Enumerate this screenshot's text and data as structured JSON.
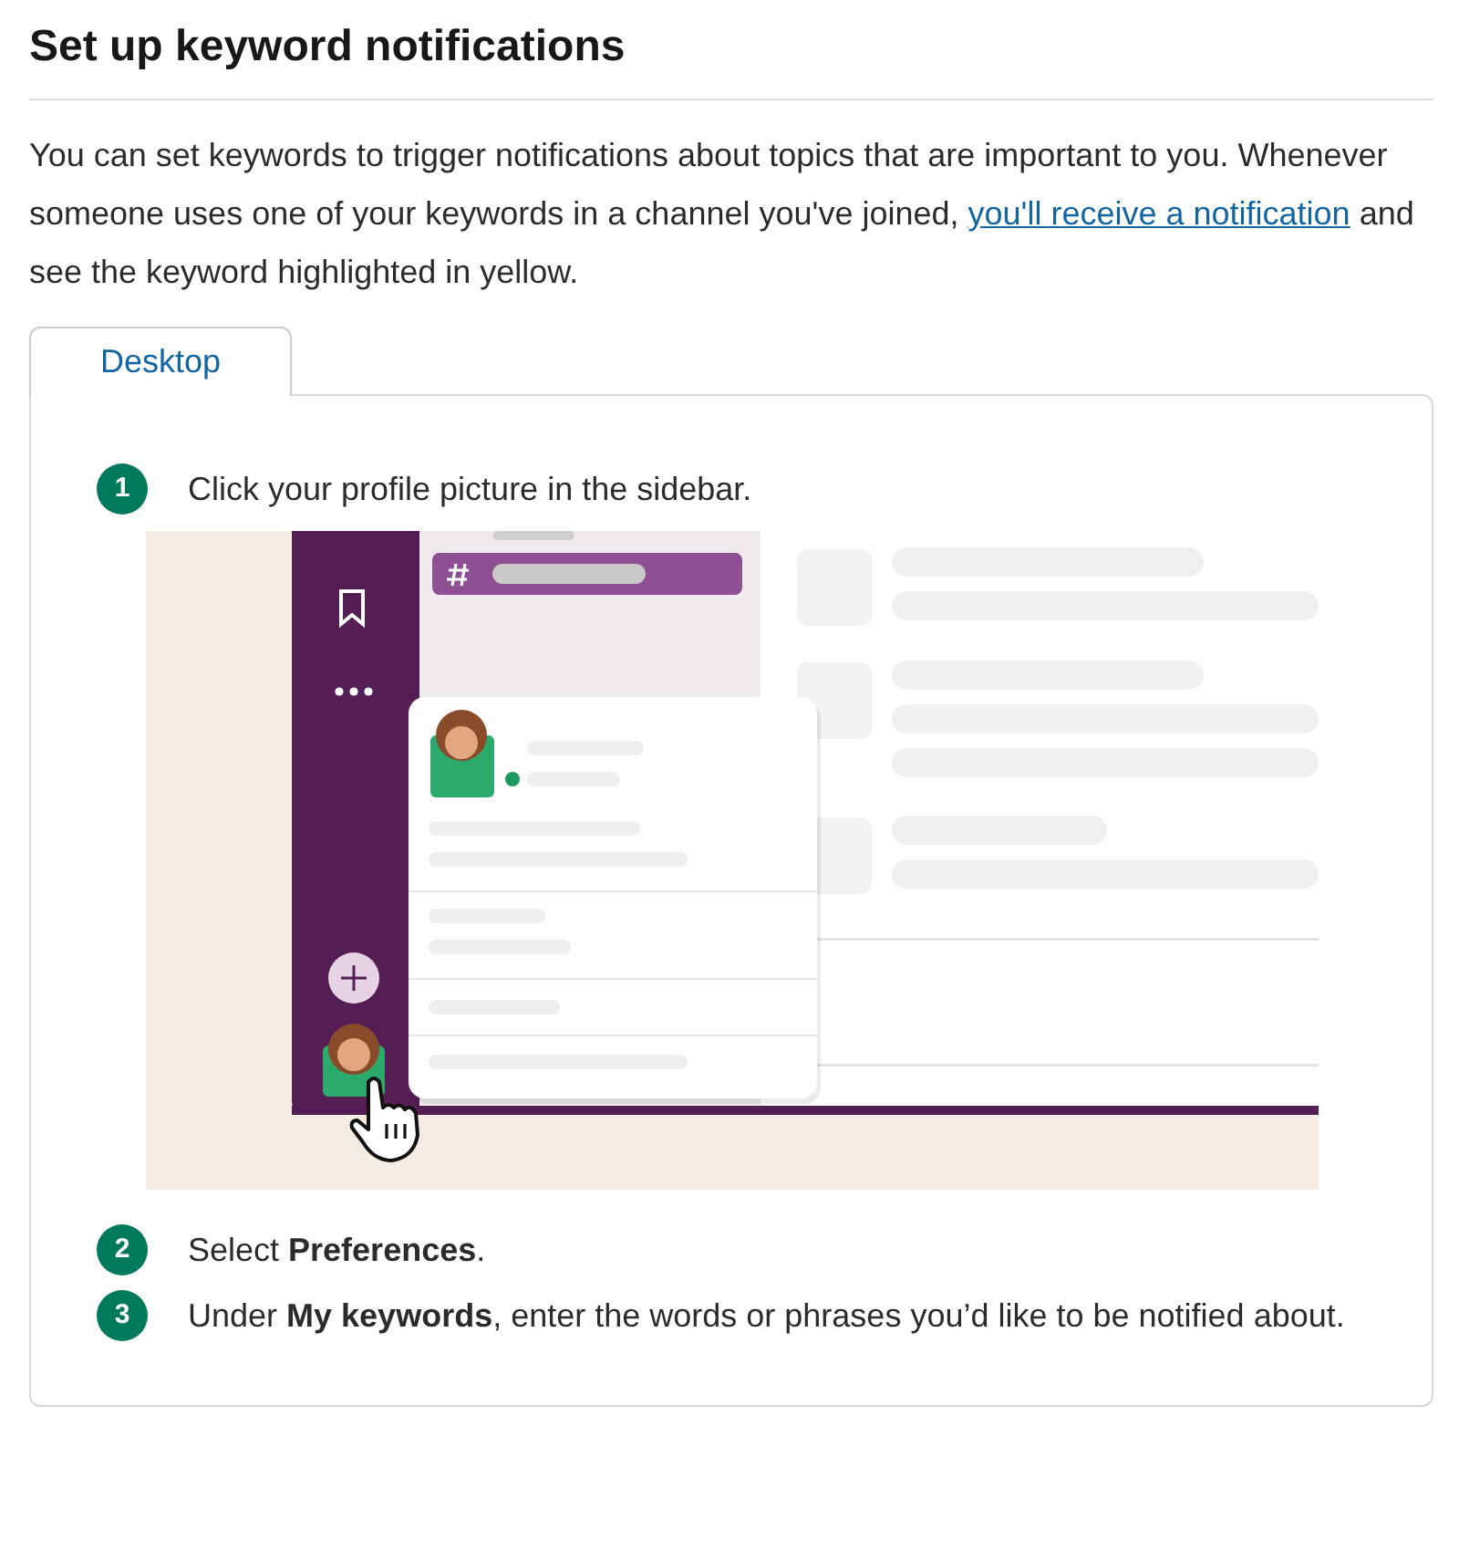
{
  "title": "Set up keyword notifications",
  "intro": {
    "before": "You can set keywords to trigger notifications about topics that are important to you. Whenever someone uses one of your keywords in a channel you've joined,",
    "link": "you'll receive a notification",
    "after": "and see the keyword highlighted in yellow."
  },
  "tabs": [
    {
      "label": "Desktop",
      "selected": true
    }
  ],
  "steps": [
    {
      "number": "1",
      "text": "Click your profile picture in the sidebar.",
      "kind": "illustrated"
    },
    {
      "number": "2",
      "text": "Select **Preferences**.",
      "kind": "plain"
    },
    {
      "number": "3",
      "text": "Under **My keywords**, enter the words or phrases you’d like to be notified about.",
      "kind": "plain"
    }
  ]
}
